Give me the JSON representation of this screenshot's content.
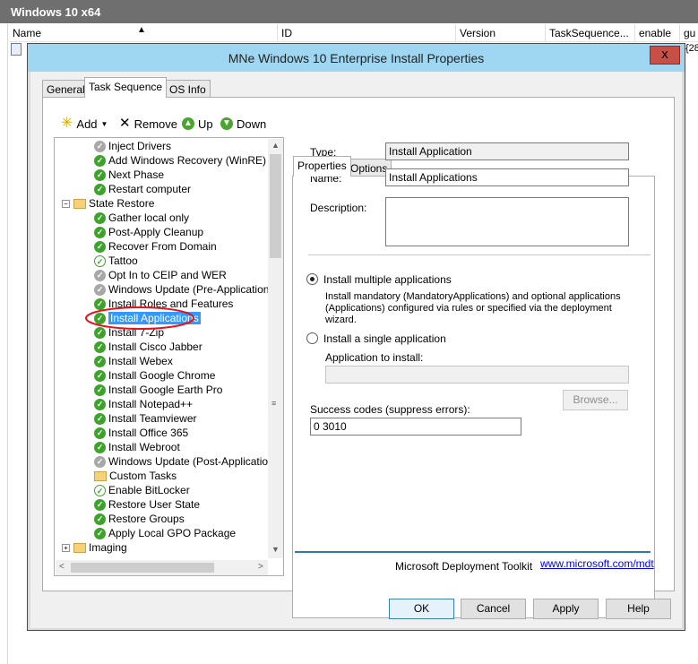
{
  "background_window": {
    "title": "Windows 10 x64",
    "columns": [
      {
        "label": "Name",
        "sort": "▲"
      },
      {
        "label": "ID"
      },
      {
        "label": "Version"
      },
      {
        "label": "TaskSequence..."
      },
      {
        "label": "enable"
      },
      {
        "label": "gu"
      }
    ],
    "row_fragment": "{28"
  },
  "dialog": {
    "title": "MNe Windows 10 Enterprise Install Properties",
    "close_glyph": "x",
    "tabs": [
      "General",
      "Task Sequence",
      "OS Info"
    ],
    "active_tab": "Task Sequence",
    "toolbar": {
      "add": "Add",
      "remove": "Remove",
      "up": "Up",
      "down": "Down"
    },
    "tree": [
      {
        "label": "Inject Drivers",
        "state": "off",
        "indent": 2
      },
      {
        "label": "Add Windows Recovery (WinRE)",
        "state": "on",
        "indent": 2
      },
      {
        "label": "Next Phase",
        "state": "on",
        "indent": 2
      },
      {
        "label": "Restart computer",
        "state": "on",
        "indent": 2
      },
      {
        "label": "State Restore",
        "state": "folder",
        "indent": 1,
        "expander": "−"
      },
      {
        "label": "Gather local only",
        "state": "on",
        "indent": 2
      },
      {
        "label": "Post-Apply Cleanup",
        "state": "on",
        "indent": 2
      },
      {
        "label": "Recover From Domain",
        "state": "on",
        "indent": 2
      },
      {
        "label": "Tattoo",
        "state": "white",
        "indent": 2
      },
      {
        "label": "Opt In to CEIP and WER",
        "state": "off",
        "indent": 2
      },
      {
        "label": "Windows Update (Pre-Application Inst",
        "state": "off",
        "indent": 2
      },
      {
        "label": "Install Roles and Features",
        "state": "on",
        "indent": 2
      },
      {
        "label": "Install Applications",
        "state": "on",
        "indent": 2,
        "selected": true
      },
      {
        "label": "Install 7-Zip",
        "state": "on",
        "indent": 2
      },
      {
        "label": "Install Cisco Jabber",
        "state": "on",
        "indent": 2
      },
      {
        "label": "Install Webex",
        "state": "on",
        "indent": 2
      },
      {
        "label": "Install Google Chrome",
        "state": "on",
        "indent": 2
      },
      {
        "label": "Install Google Earth Pro",
        "state": "on",
        "indent": 2
      },
      {
        "label": "Install Notepad++",
        "state": "on",
        "indent": 2
      },
      {
        "label": "Install Teamviewer",
        "state": "on",
        "indent": 2
      },
      {
        "label": "Install Office 365",
        "state": "on",
        "indent": 2
      },
      {
        "label": "Install Webroot",
        "state": "on",
        "indent": 2
      },
      {
        "label": "Windows Update (Post-Application Ins",
        "state": "off",
        "indent": 2
      },
      {
        "label": "Custom Tasks",
        "state": "folder",
        "indent": 2
      },
      {
        "label": "Enable BitLocker",
        "state": "white",
        "indent": 2
      },
      {
        "label": "Restore User State",
        "state": "on",
        "indent": 2
      },
      {
        "label": "Restore Groups",
        "state": "on",
        "indent": 2
      },
      {
        "label": "Apply Local GPO Package",
        "state": "on",
        "indent": 2
      },
      {
        "label": "Imaging",
        "state": "folder",
        "indent": 1,
        "expander": "+"
      }
    ],
    "props_tabs": [
      "Properties",
      "Options"
    ],
    "props": {
      "type_label": "Type:",
      "type_value": "Install Application",
      "name_label": "Name:",
      "name_value": "Install Applications",
      "description_label": "Description:",
      "description_value": "",
      "radio_multiple": "Install multiple applications",
      "radio_multiple_desc": "Install mandatory (MandatoryApplications) and optional applications (Applications) configured via rules or specified via the deployment wizard.",
      "radio_single": "Install a single application",
      "app_to_install_label": "Application to install:",
      "app_to_install_value": "",
      "browse": "Browse...",
      "success_codes_label": "Success codes (suppress errors):",
      "success_codes_value": "0 3010",
      "selected_option": "multiple"
    },
    "footer": {
      "toolkit": "Microsoft Deployment Toolkit",
      "link": "www.microsoft.com/mdt"
    },
    "buttons": {
      "ok": "OK",
      "cancel": "Cancel",
      "apply": "Apply",
      "help": "Help"
    }
  }
}
